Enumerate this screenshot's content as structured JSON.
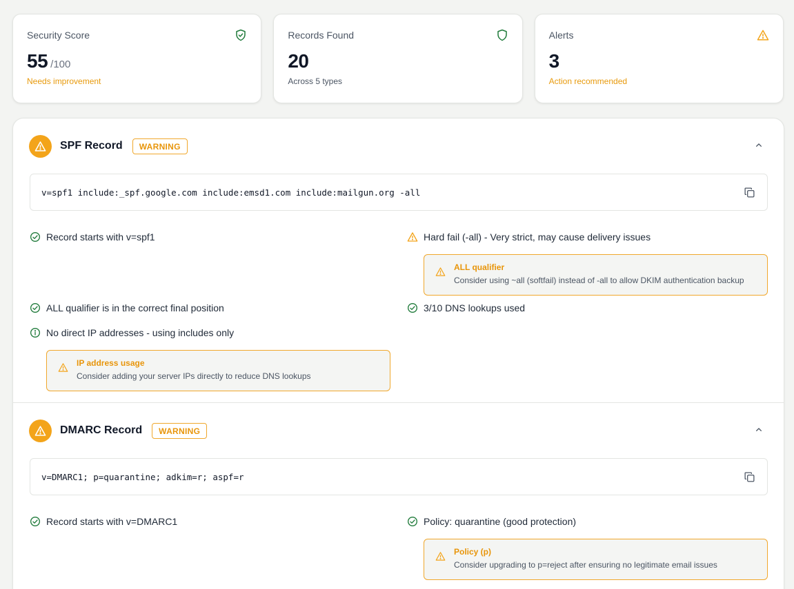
{
  "stats": [
    {
      "label": "Security Score",
      "value": "55",
      "suffix": "/100",
      "sub": "Needs improvement",
      "icon": "shield-check-icon"
    },
    {
      "label": "Records Found",
      "value": "20",
      "suffix": "",
      "sub": "Across 5 types",
      "icon": "shield-icon"
    },
    {
      "label": "Alerts",
      "value": "3",
      "suffix": "",
      "sub": "Action recommended",
      "icon": "warning-triangle-icon"
    }
  ],
  "colors": {
    "accent_green": "#1f7a3a",
    "warning_orange": "#f3a41a",
    "warning_text": "#e8950a"
  },
  "spf": {
    "title": "SPF Record",
    "status": "WARNING",
    "record": "v=spf1 include:_spf.google.com include:emsd1.com include:mailgun.org -all",
    "checks": {
      "starts": "Record starts with v=spf1",
      "hardfail": "Hard fail (-all) - Very strict, may cause delivery issues",
      "position": "ALL qualifier is in the correct final position",
      "lookups": "3/10 DNS lookups used",
      "noip": "No direct IP addresses - using includes only"
    },
    "hints": {
      "all_title": "ALL qualifier",
      "all_text": "Consider using ~all (softfail) instead of -all to allow DKIM authentication backup",
      "ip_title": "IP address usage",
      "ip_text": "Consider adding your server IPs directly to reduce DNS lookups"
    }
  },
  "dmarc": {
    "title": "DMARC Record",
    "status": "WARNING",
    "record": "v=DMARC1; p=quarantine; adkim=r; aspf=r",
    "checks": {
      "starts": "Record starts with v=DMARC1",
      "policy": "Policy: quarantine (good protection)"
    },
    "hints": {
      "policy_title": "Policy (p)",
      "policy_text": "Consider upgrading to p=reject after ensuring no legitimate email issues"
    }
  }
}
